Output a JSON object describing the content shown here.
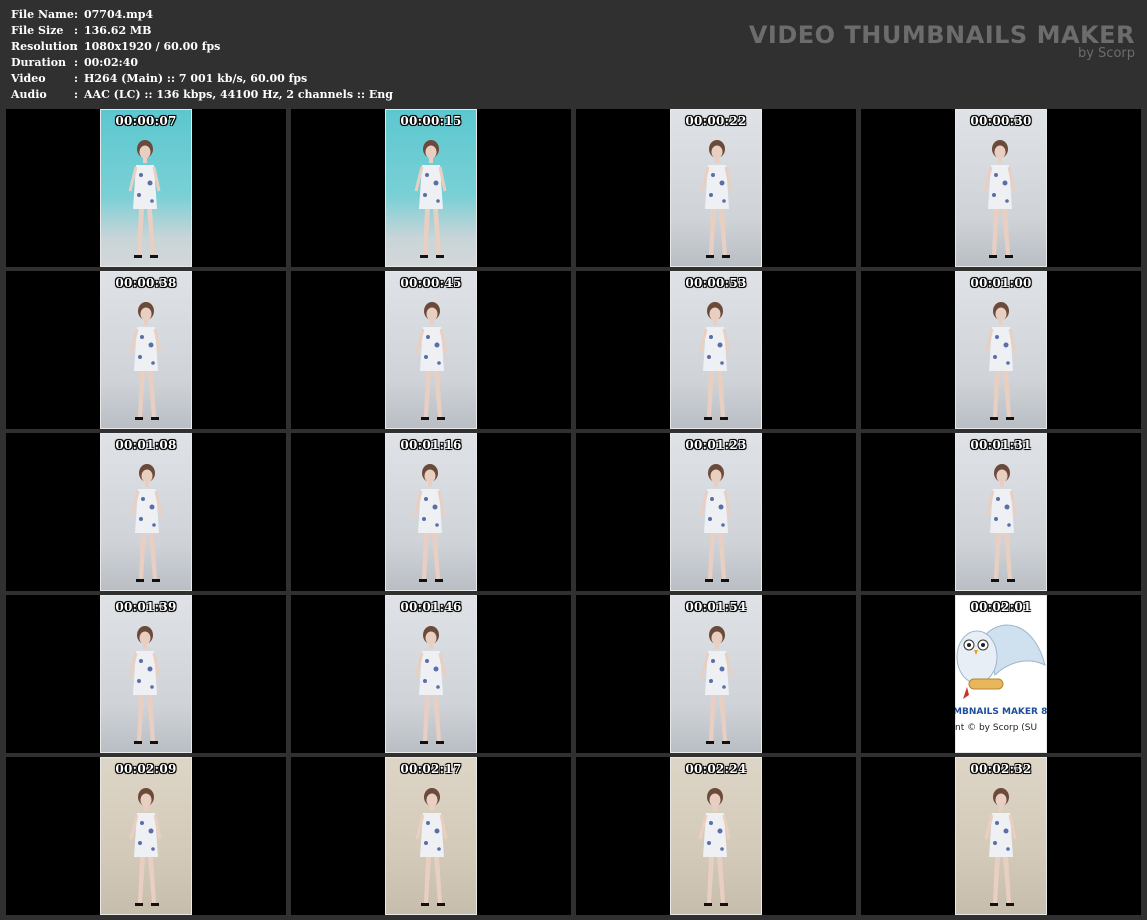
{
  "info": {
    "rows": [
      {
        "label": "File Name",
        "value": "07704.mp4"
      },
      {
        "label": "File Size",
        "value": "136.62 MB"
      },
      {
        "label": "Resolution",
        "value": "1080x1920 / 60.00 fps"
      },
      {
        "label": "Duration",
        "value": "00:02:40"
      },
      {
        "label": "Video",
        "value": "H264 (Main) :: 7 001 kb/s, 60.00 fps"
      },
      {
        "label": "Audio",
        "value": "AAC (LC) :: 136 kbps, 44100 Hz, 2 channels :: Eng"
      }
    ],
    "separator": ":"
  },
  "brand": {
    "title": "VIDEO THUMBNAILS MAKER",
    "subtitle": "by Scorp"
  },
  "logo_tile": {
    "line1": "MBNAILS MAKER 8",
    "line2": "nt © by Scorp (SU"
  },
  "thumbnails": [
    {
      "timestamp": "00:00:07",
      "style": "teal"
    },
    {
      "timestamp": "00:00:15",
      "style": "teal"
    },
    {
      "timestamp": "00:00:22",
      "style": "gray"
    },
    {
      "timestamp": "00:00:30",
      "style": "gray"
    },
    {
      "timestamp": "00:00:38",
      "style": "gray"
    },
    {
      "timestamp": "00:00:45",
      "style": "gray"
    },
    {
      "timestamp": "00:00:53",
      "style": "gray"
    },
    {
      "timestamp": "00:01:00",
      "style": "gray"
    },
    {
      "timestamp": "00:01:08",
      "style": "gray"
    },
    {
      "timestamp": "00:01:16",
      "style": "gray"
    },
    {
      "timestamp": "00:01:23",
      "style": "gray"
    },
    {
      "timestamp": "00:01:31",
      "style": "gray"
    },
    {
      "timestamp": "00:01:39",
      "style": "gray"
    },
    {
      "timestamp": "00:01:46",
      "style": "gray"
    },
    {
      "timestamp": "00:01:54",
      "style": "gray"
    },
    {
      "timestamp": "00:02:01",
      "style": "logo"
    },
    {
      "timestamp": "00:02:09",
      "style": "warm"
    },
    {
      "timestamp": "00:02:17",
      "style": "warm"
    },
    {
      "timestamp": "00:02:24",
      "style": "warm"
    },
    {
      "timestamp": "00:02:32",
      "style": "warm"
    }
  ],
  "colors": {
    "background": "#303030",
    "cell": "#000000",
    "text": "#ffffff",
    "brand": "#6c6c6c"
  }
}
